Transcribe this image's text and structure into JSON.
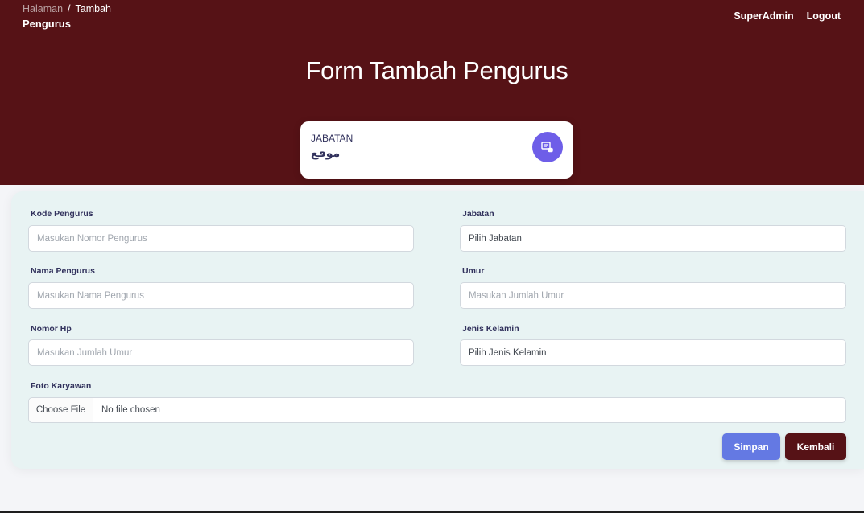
{
  "breadcrumb": {
    "root": "Halaman",
    "separator": "/",
    "current": "Tambah"
  },
  "section_title": "Pengurus",
  "nav": {
    "user": "SuperAdmin",
    "logout": "Logout"
  },
  "page_title": "Form Tambah Pengurus",
  "stat_card": {
    "label": "JABATAN",
    "value": "موقع",
    "icon": "database-icon",
    "icon_color": "#6e5ee8"
  },
  "form": {
    "kode": {
      "label": "Kode Pengurus",
      "placeholder": "Masukan Nomor Pengurus"
    },
    "jabatan": {
      "label": "Jabatan",
      "value": "Pilih Jabatan"
    },
    "nama": {
      "label": "Nama Pengurus",
      "placeholder": "Masukan Nama Pengurus"
    },
    "umur": {
      "label": "Umur",
      "placeholder": "Masukan Jumlah Umur"
    },
    "hp": {
      "label": "Nomor Hp",
      "placeholder": "Masukan Jumlah Umur"
    },
    "jk": {
      "label": "Jenis Kelamin",
      "value": "Pilih Jenis Kelamin"
    },
    "foto": {
      "label": "Foto Karyawan",
      "button": "Choose File",
      "status": "No file chosen"
    }
  },
  "buttons": {
    "save": "Simpan",
    "back": "Kembali"
  },
  "colors": {
    "header_bg": "#561216",
    "primary": "#6479e3",
    "back_button": "#561216"
  }
}
